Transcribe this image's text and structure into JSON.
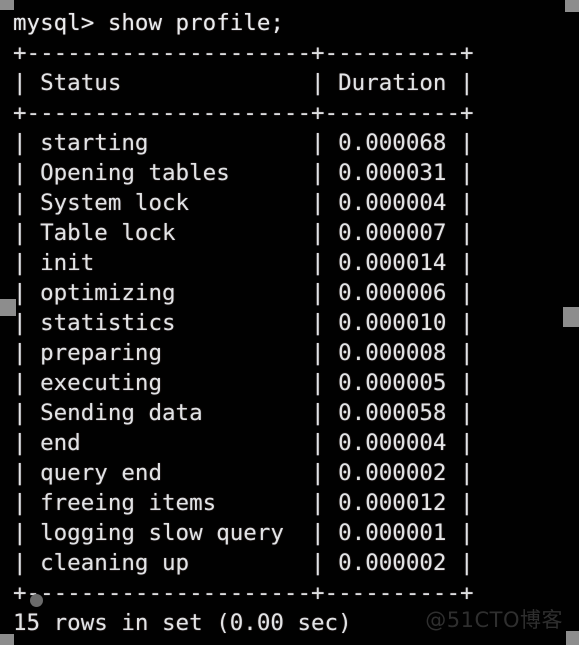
{
  "terminal": {
    "prompt_line": "mysql> show profile;",
    "rule_top": "+---------------------+----------+",
    "rule_header": "+---------------------+----------+",
    "rule_bottom": "+---------------------+----------+",
    "header_row": "| Status              | Duration |",
    "footer_line": "15 rows in set (0.00 sec)",
    "columns": [
      "Status",
      "Duration"
    ],
    "rows": [
      {
        "status": "starting",
        "duration": "0.000068"
      },
      {
        "status": "Opening tables",
        "duration": "0.000031"
      },
      {
        "status": "System lock",
        "duration": "0.000004"
      },
      {
        "status": "Table lock",
        "duration": "0.000007"
      },
      {
        "status": "init",
        "duration": "0.000014"
      },
      {
        "status": "optimizing",
        "duration": "0.000006"
      },
      {
        "status": "statistics",
        "duration": "0.000010"
      },
      {
        "status": "preparing",
        "duration": "0.000008"
      },
      {
        "status": "executing",
        "duration": "0.000005"
      },
      {
        "status": "Sending data",
        "duration": "0.000058"
      },
      {
        "status": "end",
        "duration": "0.000004"
      },
      {
        "status": "query end",
        "duration": "0.000002"
      },
      {
        "status": "freeing items",
        "duration": "0.000012"
      },
      {
        "status": "logging slow query",
        "duration": "0.000001"
      },
      {
        "status": "cleaning up",
        "duration": "0.000002"
      }
    ],
    "row_lines": [
      "| starting            | 0.000068 |",
      "| Opening tables      | 0.000031 |",
      "| System lock         | 0.000004 |",
      "| Table lock          | 0.000007 |",
      "| init                | 0.000014 |",
      "| optimizing          | 0.000006 |",
      "| statistics          | 0.000010 |",
      "| preparing           | 0.000008 |",
      "| executing           | 0.000005 |",
      "| Sending data        | 0.000058 |",
      "| end                 | 0.000004 |",
      "| query end           | 0.000002 |",
      "| freeing items       | 0.000012 |",
      "| logging slow query  | 0.000001 |",
      "| cleaning up         | 0.000002 |"
    ]
  },
  "watermark": {
    "text": "@51CTO博客"
  },
  "colors": {
    "background": "#010101",
    "foreground": "#e4e4e4",
    "handle": "#8d8d8d",
    "watermark": "#2f2f2f"
  }
}
